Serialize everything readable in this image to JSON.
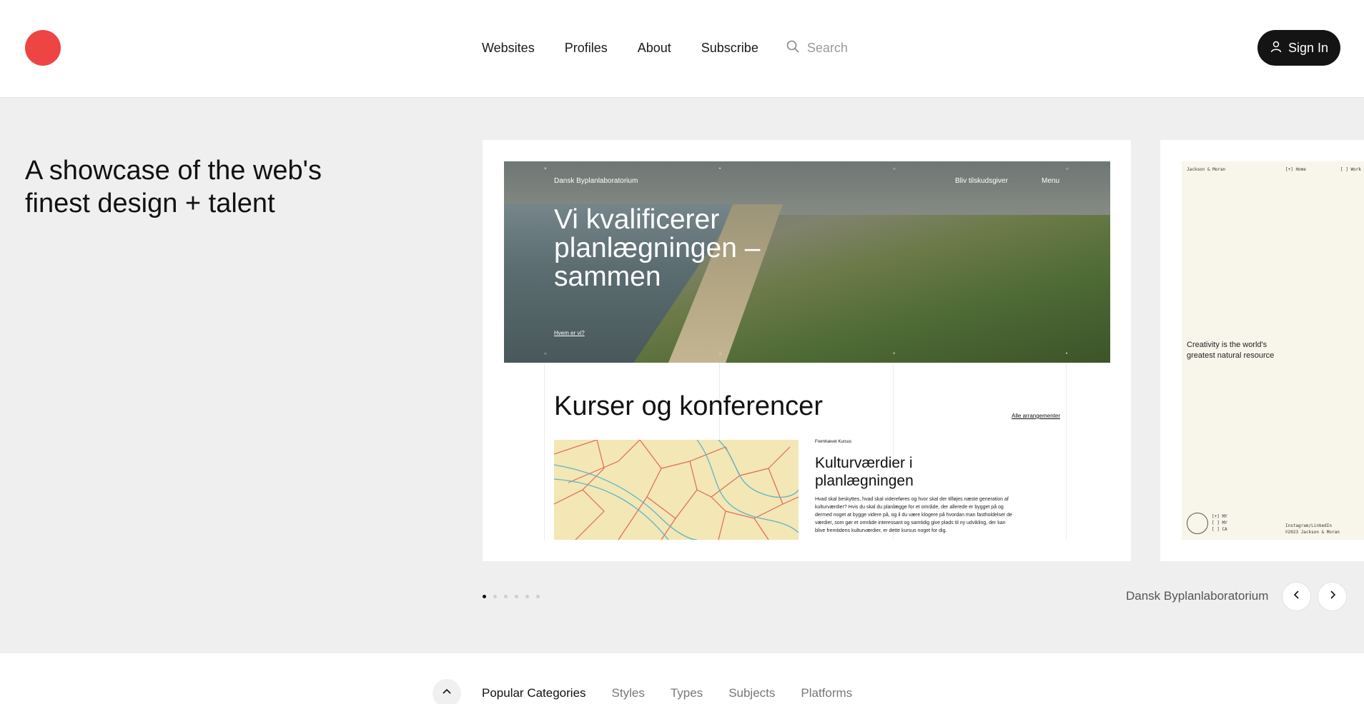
{
  "header": {
    "nav": [
      "Websites",
      "Profiles",
      "About",
      "Subscribe"
    ],
    "search_placeholder": "Search",
    "signin_label": "Sign In"
  },
  "hero": {
    "title_line1": "A showcase of the web's",
    "title_line2": "finest design + talent"
  },
  "slide": {
    "site_name": "Dansk Byplanlaboratorium",
    "nav_link1": "Bliv tilskudsgiver",
    "nav_link2": "Menu",
    "headline_l1": "Vi kvalificerer",
    "headline_l2": "planlægningen –",
    "headline_l3": "sammen",
    "hero_link": "Hvem er vi?",
    "section_title": "Kurser og konferencer",
    "section_link": "Alle arrangementer",
    "featured_kicker": "Fremhævet Kursus",
    "featured_title": "Kulturværdier i planlægningen",
    "featured_body": "Hvad skal beskyttes, hvad skal videreføres og hvor skal der tilføjes næste generation af kulturværdier? Hvis du skal du planlægge for et område, der allerede er bygget på og dermed noget at bygge videre på, og il du være klogere på hvordan man fastholdelser de værdier, som gør et område interessant og samtidig give plads til ny udvikling, der kan blive fremtidens kulturværdier, er dette kursus noget for dig."
  },
  "slide2": {
    "brand": "Jackson & Moran",
    "nav1": "[+] Home",
    "nav2": "[ ] Work",
    "headline": "Creativity is the world's greatest natural resource",
    "list1": "[+] MY",
    "list2": "[ ] MY",
    "list3": "[ ] CA",
    "footer1": "Instagram/LinkedIn",
    "footer2": "©2023 Jackson & Moran"
  },
  "carousel": {
    "dots_count": 6,
    "active_index": 0,
    "current_label": "Dansk Byplanlaboratorium"
  },
  "categories": {
    "tabs": [
      "Popular Categories",
      "Styles",
      "Types",
      "Subjects",
      "Platforms"
    ],
    "active": "Popular Categories"
  },
  "colors": {
    "brand": "#ef4444",
    "dark": "#141414",
    "page_bg": "#efefef"
  },
  "icons": {
    "search": "search-icon",
    "user": "user-icon",
    "prev": "chevron-left-icon",
    "next": "chevron-right-icon",
    "collapse": "chevron-up-icon"
  }
}
